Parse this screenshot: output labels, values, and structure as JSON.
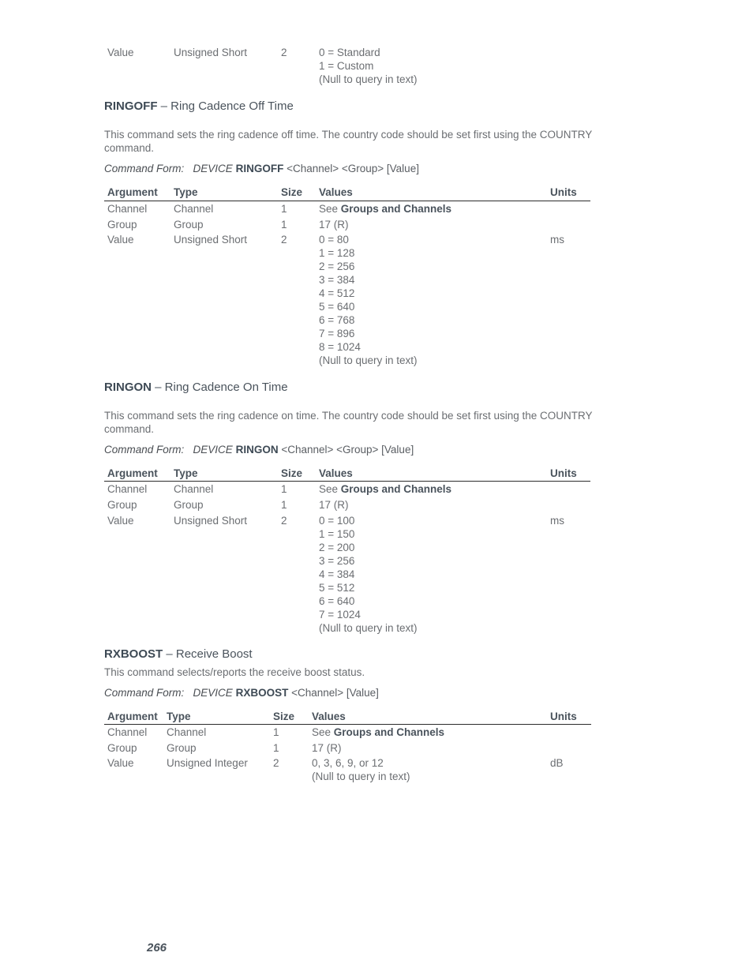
{
  "top_continuation": {
    "argument": "Value",
    "type": "Unsigned Short",
    "size": "2",
    "values": [
      "0 = Standard",
      "1 = Custom",
      "(Null to query in text)"
    ]
  },
  "table_headers": {
    "argument": "Argument",
    "type": "Type",
    "size": "Size",
    "values": "Values",
    "units": "Units"
  },
  "common": {
    "see": "See",
    "groups_and_channels": "Groups and Channels",
    "command_form_label": "Command Form:",
    "device": "DEVICE"
  },
  "sections": [
    {
      "command": "RINGOFF",
      "dash_title": " – Ring Cadence Off Time",
      "description": "This command sets the ring cadence off time. The country code should be set first using the COUNTRY command.",
      "command_form_args": " <Channel> <Group> [Value]",
      "rows": [
        {
          "argument": "Channel",
          "type": "Channel",
          "size": "1",
          "units": ""
        },
        {
          "argument": "Group",
          "type": "Group",
          "size": "1",
          "value": "17 (R)",
          "units": ""
        },
        {
          "argument": "Value",
          "type": "Unsigned Short",
          "size": "2",
          "values": [
            "0 = 80",
            "1 = 128",
            "2 = 256",
            "3 = 384",
            "4 = 512",
            "5 = 640",
            "6 = 768",
            "7 = 896",
            "8 = 1024",
            "(Null to query in text)"
          ],
          "units": "ms"
        }
      ]
    },
    {
      "command": "RINGON",
      "dash_title": " – Ring Cadence On Time",
      "description": "This command sets the ring cadence on time. The country code should be set first using the COUNTRY command.",
      "command_form_args": " <Channel> <Group> [Value]",
      "rows": [
        {
          "argument": "Channel",
          "type": "Channel",
          "size": "1",
          "units": ""
        },
        {
          "argument": "Group",
          "type": "Group",
          "size": "1",
          "value": "17 (R)",
          "units": ""
        },
        {
          "argument": "Value",
          "type": "Unsigned Short",
          "size": "2",
          "values": [
            "0 = 100",
            "1 = 150",
            "2 = 200",
            "3 = 256",
            "4 = 384",
            "5 = 512",
            "6 = 640",
            "7 = 1024",
            "(Null to query in text)"
          ],
          "units": "ms"
        }
      ]
    },
    {
      "command": "RXBOOST",
      "dash_title": " – Receive Boost",
      "description": "This command selects/reports the receive boost status.",
      "command_form_args": " <Channel> [Value]",
      "rows": [
        {
          "argument": "Channel",
          "type": "Channel",
          "size": "1",
          "units": ""
        },
        {
          "argument": "Group",
          "type": "Group",
          "size": "1",
          "value": "17 (R)",
          "units": ""
        },
        {
          "argument": "Value",
          "type": "Unsigned Integer",
          "size": "2",
          "values": [
            "0, 3, 6, 9, or 12",
            "(Null to query in text)"
          ],
          "units": "dB"
        }
      ]
    }
  ],
  "page_number": "266"
}
